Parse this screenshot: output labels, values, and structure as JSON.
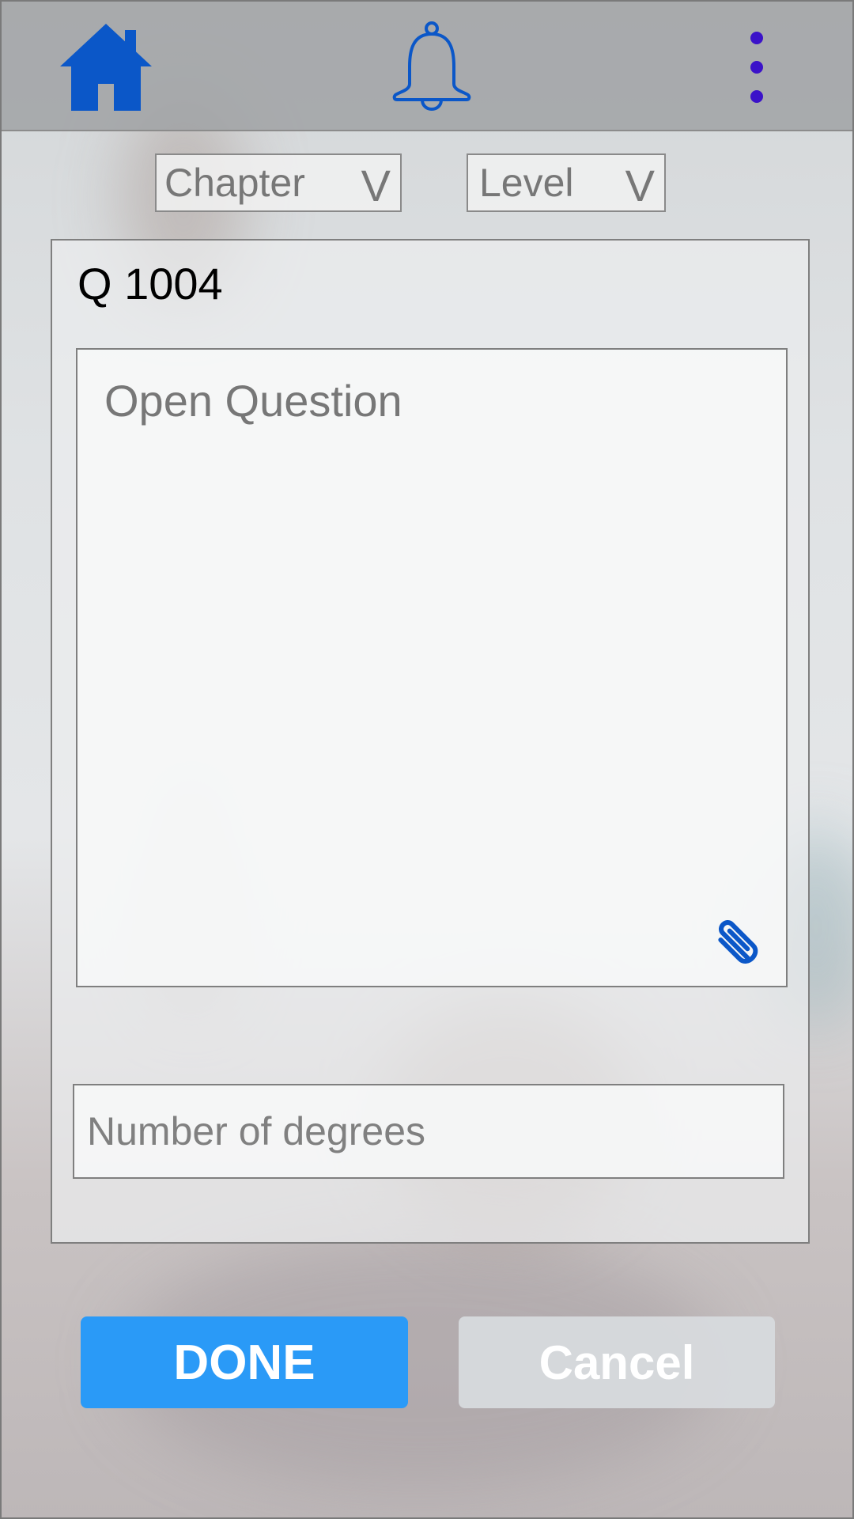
{
  "topbar": {
    "home_icon": "home-icon",
    "bell_icon": "bell-icon",
    "menu_icon": "more-vertical-icon"
  },
  "filters": {
    "chapter_label": "Chapter",
    "level_label": "Level",
    "chevron_glyph": "V"
  },
  "question": {
    "id_label": "Q 1004",
    "placeholder": "Open Question",
    "attach_icon": "paperclip-icon"
  },
  "degrees": {
    "placeholder": "Number of degrees"
  },
  "actions": {
    "done_label": "DONE",
    "cancel_label": "Cancel"
  },
  "colors": {
    "primary_blue": "#0b57c8",
    "menu_dots": "#3b12c9",
    "done_button": "#2a9af7"
  }
}
